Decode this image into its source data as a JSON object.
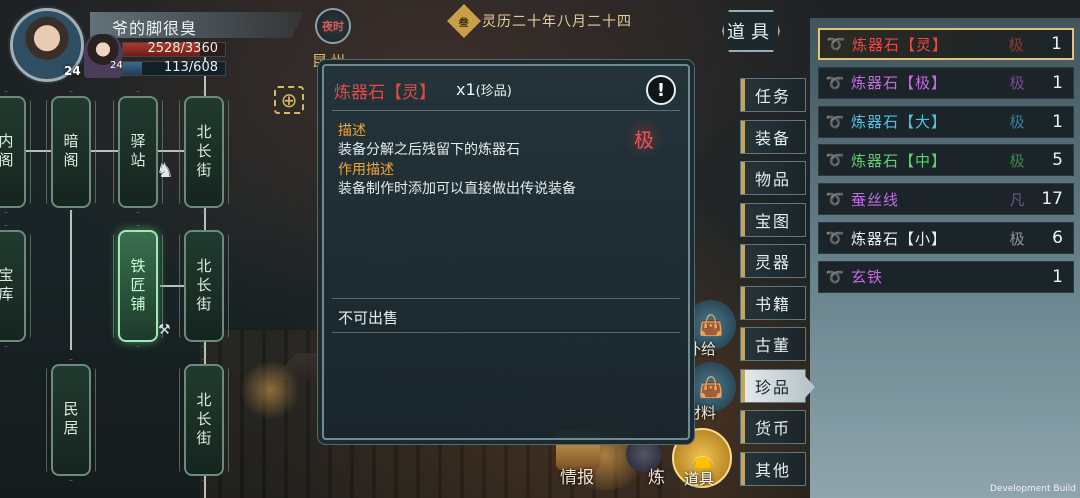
{
  "player": {
    "name": "爷的脚很臭",
    "level": "24",
    "companion_level": "24",
    "hp_text": "2528/3360",
    "hp_fraction": 0.7524,
    "mp_text": "113/608",
    "mp_fraction": 0.1859
  },
  "topbar": {
    "day_badge": "夜时",
    "city": "昆州",
    "date_seal": "叁",
    "date": "灵历二十年八月二十四"
  },
  "map": {
    "nodes": [
      "内阁",
      "暗阁",
      "驿站",
      "北长街",
      "宝库",
      "铁匠铺",
      "北长街",
      "民居",
      "北长街"
    ]
  },
  "popup": {
    "title": "炼器石【灵】",
    "qty_prefix": "x1",
    "qty_suffix": "(珍品)",
    "grade_tag": "极",
    "desc_heading": "描述",
    "desc_text": "装备分解之后残留下的炼器石",
    "use_heading": "作用描述",
    "use_text": "装备制作时添加可以直接做出传说装备",
    "sale_note": "不可出售",
    "info_icon": "!"
  },
  "category": {
    "title": "道具",
    "tabs": [
      {
        "label": "任务"
      },
      {
        "label": "装备"
      },
      {
        "label": "物品"
      },
      {
        "label": "宝图"
      },
      {
        "label": "灵器"
      },
      {
        "label": "书籍"
      },
      {
        "label": "古董"
      },
      {
        "label": "珍品"
      },
      {
        "label": "货币"
      },
      {
        "label": "其他"
      }
    ],
    "selected": "珍品"
  },
  "items": [
    {
      "name": "炼器石【灵】",
      "grade": "极",
      "count": "1",
      "color": "#e84a4a"
    },
    {
      "name": "炼器石【极】",
      "grade": "极",
      "count": "1",
      "color": "#c46ae0"
    },
    {
      "name": "炼器石【大】",
      "grade": "极",
      "count": "1",
      "color": "#4fc3e6"
    },
    {
      "name": "炼器石【中】",
      "grade": "极",
      "count": "5",
      "color": "#5fd06a"
    },
    {
      "name": "蚕丝线",
      "grade": "凡",
      "count": "17",
      "color": "#c46ae0"
    },
    {
      "name": "炼器石【小】",
      "grade": "极",
      "count": "6",
      "color": "#e9eef0"
    },
    {
      "name": "玄铁",
      "grade": "",
      "count": "1",
      "color": "#c46ae0"
    }
  ],
  "bottom_menu": {
    "supply_label": "补给",
    "material_label": "材料",
    "intel_label": "情报",
    "craft_label": "炼",
    "items_label": "道具"
  },
  "dev_build": "Development Build",
  "colors": {
    "rare_red": "#e34848",
    "heading_orange": "#f0a43a",
    "gold": "#d9b862"
  }
}
